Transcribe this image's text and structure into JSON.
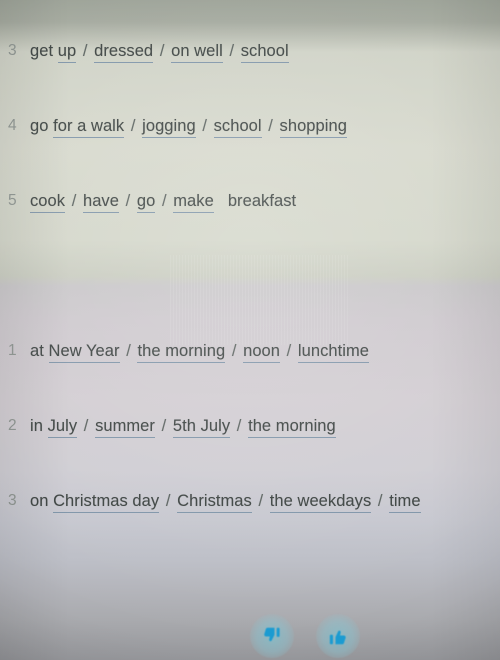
{
  "worksheet": {
    "colors": {
      "text": "#3b4240",
      "number": "#8d9490",
      "underline": "#7e94a8",
      "paper_top": "#d6d8cc",
      "paper_bottom": "#c6c7cf",
      "icon_accent": "#1b9bd1"
    },
    "sections": [
      {
        "id": "section-1",
        "rows": [
          {
            "number": "3",
            "lead": "get",
            "options": [
              {
                "text": "up",
                "underlined": true
              },
              {
                "text": "dressed",
                "underlined": true
              },
              {
                "text": "on well",
                "underlined": true,
                "prefix": "on "
              },
              {
                "text": "school",
                "underlined": true
              }
            ],
            "trailing": ""
          },
          {
            "number": "4",
            "lead": "go",
            "options": [
              {
                "text": "for a walk",
                "underlined": true
              },
              {
                "text": "jogging",
                "underlined": true
              },
              {
                "text": "school",
                "underlined": true
              },
              {
                "text": "shopping",
                "underlined": true
              }
            ],
            "trailing": ""
          },
          {
            "number": "5",
            "lead": "",
            "options": [
              {
                "text": "cook",
                "underlined": true
              },
              {
                "text": "have",
                "underlined": true
              },
              {
                "text": "go",
                "underlined": true
              },
              {
                "text": "make",
                "underlined": true
              }
            ],
            "trailing": "breakfast"
          }
        ]
      },
      {
        "id": "section-2",
        "rows": [
          {
            "number": "1",
            "lead": "at",
            "options": [
              {
                "text": "New Year",
                "underlined": true
              },
              {
                "text": "the morning",
                "underlined": true
              },
              {
                "text": "noon",
                "underlined": true
              },
              {
                "text": "lunchtime",
                "underlined": true
              }
            ],
            "trailing": ""
          },
          {
            "number": "2",
            "lead": "in",
            "options": [
              {
                "text": "July",
                "underlined": true
              },
              {
                "text": "summer",
                "underlined": true
              },
              {
                "text": "5th July",
                "underlined": true
              },
              {
                "text": "the morning",
                "underlined": true
              }
            ],
            "trailing": ""
          },
          {
            "number": "3",
            "lead": "on",
            "options": [
              {
                "text": "Christmas day",
                "underlined": true
              },
              {
                "text": "Christmas",
                "underlined": true
              },
              {
                "text": "the weekdays",
                "underlined": true
              },
              {
                "text": "time",
                "underlined": true
              }
            ],
            "trailing": ""
          }
        ]
      }
    ],
    "separator": "/"
  },
  "feedback": {
    "thumbs_down": {
      "icon": "thumbs-down-icon",
      "label": ""
    },
    "thumbs_up": {
      "icon": "thumbs-up-icon",
      "label": ""
    }
  }
}
